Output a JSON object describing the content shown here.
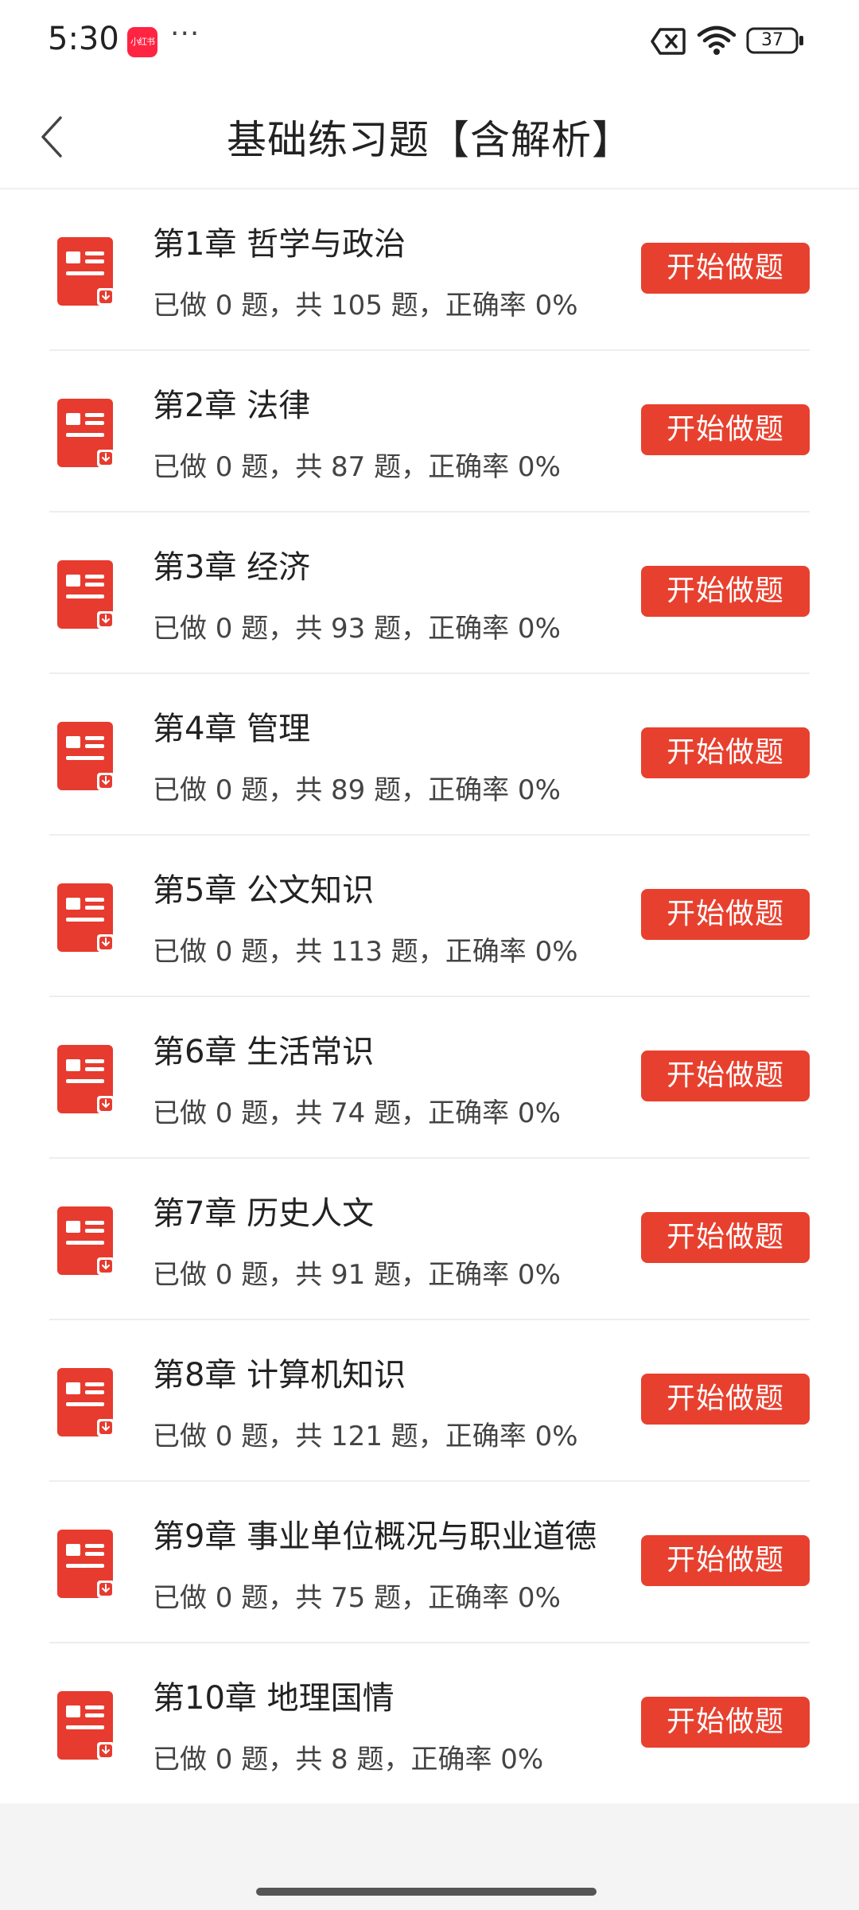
{
  "status_bar": {
    "time": "5:30",
    "app_badge": "小红书",
    "dots": "···",
    "battery": "37"
  },
  "header": {
    "title": "基础练习题【含解析】"
  },
  "colors": {
    "accent": "#e8402e",
    "icon_red": "#e63b2e"
  },
  "chapters": [
    {
      "title": "第1章 哲学与政治",
      "stats": "已做 0 题，共 105 题，正确率 0%",
      "button": "开始做题"
    },
    {
      "title": "第2章 法律",
      "stats": "已做 0 题，共 87 题，正确率 0%",
      "button": "开始做题"
    },
    {
      "title": "第3章 经济",
      "stats": "已做 0 题，共 93 题，正确率 0%",
      "button": "开始做题"
    },
    {
      "title": "第4章 管理",
      "stats": "已做 0 题，共 89 题，正确率 0%",
      "button": "开始做题"
    },
    {
      "title": "第5章 公文知识",
      "stats": "已做 0 题，共 113 题，正确率 0%",
      "button": "开始做题"
    },
    {
      "title": "第6章 生活常识",
      "stats": "已做 0 题，共 74 题，正确率 0%",
      "button": "开始做题"
    },
    {
      "title": "第7章 历史人文",
      "stats": "已做 0 题，共 91 题，正确率 0%",
      "button": "开始做题"
    },
    {
      "title": "第8章 计算机知识",
      "stats": "已做 0 题，共 121 题，正确率 0%",
      "button": "开始做题"
    },
    {
      "title": "第9章 事业单位概况与职业道德",
      "stats": "已做 0 题，共 75 题，正确率 0%",
      "button": "开始做题"
    },
    {
      "title": "第10章 地理国情",
      "stats": "已做 0 题，共 8 题，正确率 0%",
      "button": "开始做题"
    }
  ]
}
